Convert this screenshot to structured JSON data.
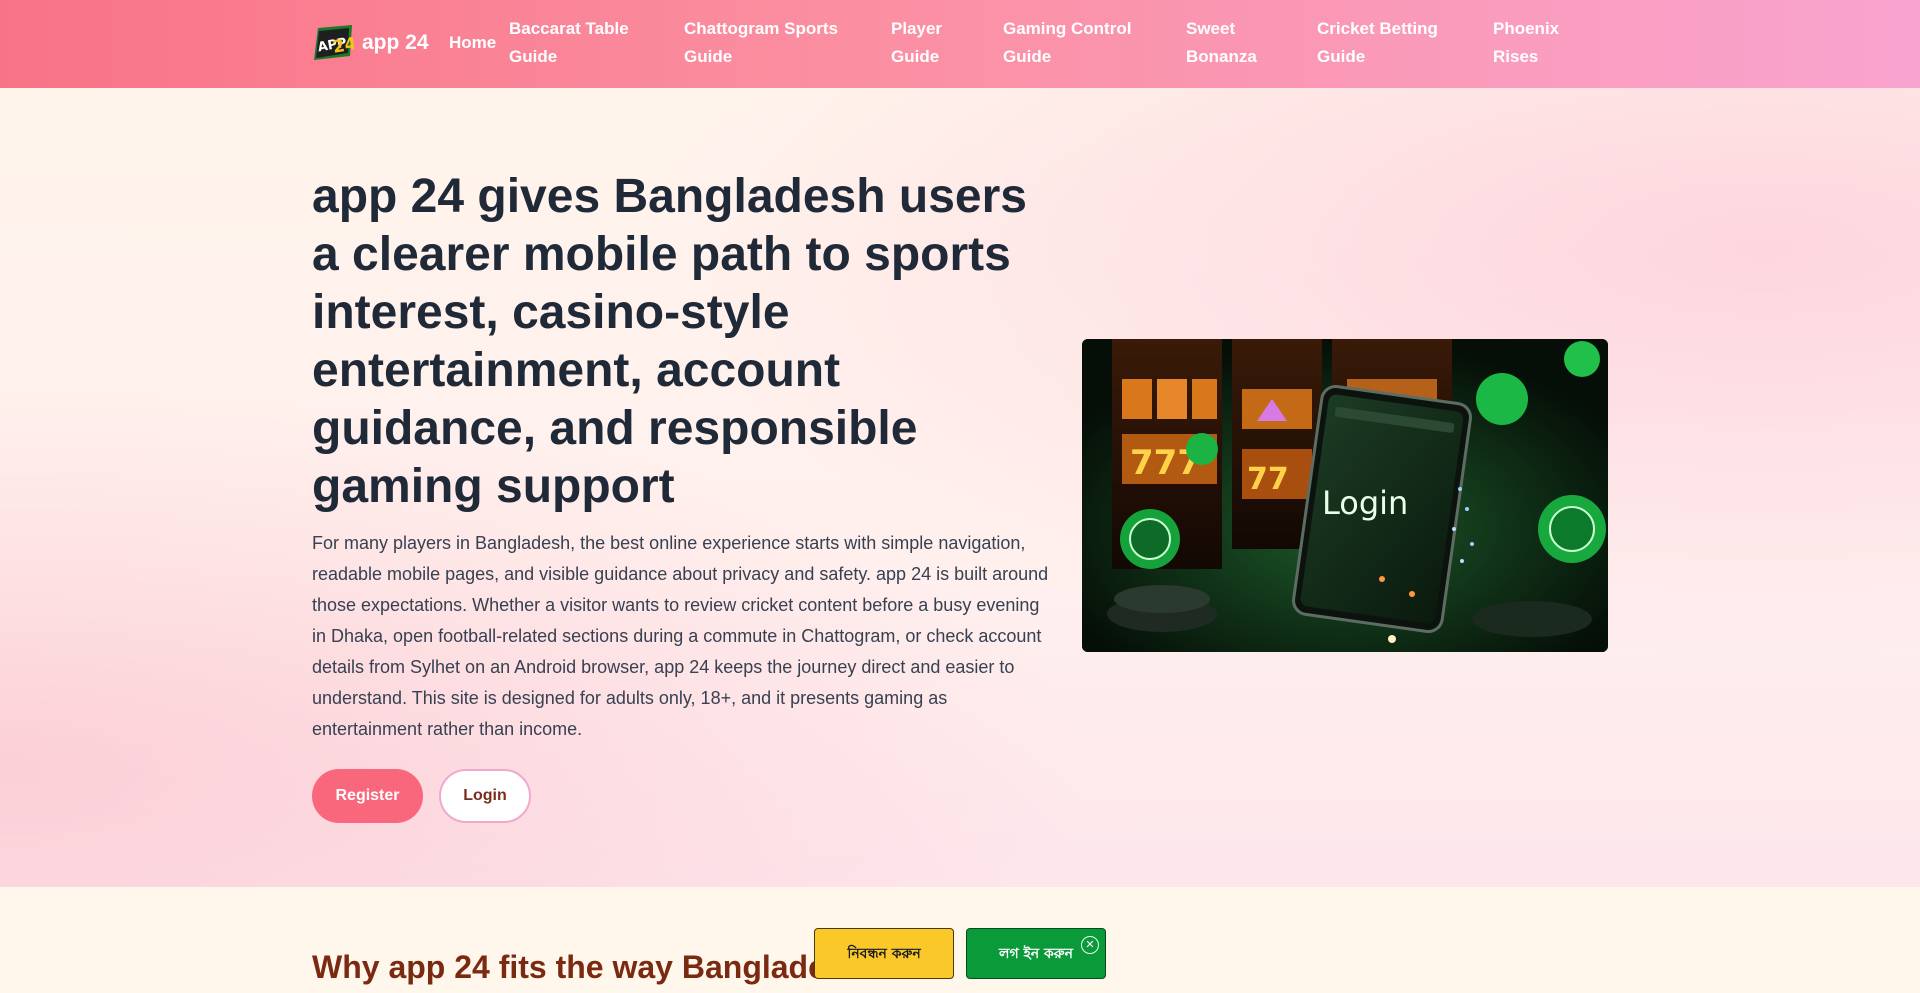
{
  "header": {
    "brand_name": "app 24",
    "logo_text": "APP24",
    "nav": [
      {
        "label": "Home"
      },
      {
        "label": "Baccarat Table Guide"
      },
      {
        "label": "Chattogram Sports Guide"
      },
      {
        "label": "Player Guide"
      },
      {
        "label": "Gaming Control Guide"
      },
      {
        "label": "Sweet Bonanza"
      },
      {
        "label": "Cricket Betting Guide"
      },
      {
        "label": "Phoenix Rises"
      }
    ]
  },
  "hero": {
    "title": "app 24 gives Bangladesh users a clearer mobile path to sports interest, casino-style entertainment, account guidance, and responsible gaming support",
    "text": "For many players in Bangladesh, the best online experience starts with simple navigation, readable mobile pages, and visible guidance about privacy and safety. app 24 is built around those expectations. Whether a visitor wants to review cricket content before a busy evening in Dhaka, open football-related sections during a commute in Chattogram, or check account details from Sylhet on an Android browser, app 24 keeps the journey direct and easier to understand. This site is designed for adults only, 18+, and it presents gaming as entertainment rather than income.",
    "register_label": "Register",
    "login_label": "Login",
    "image_label": "Login"
  },
  "section": {
    "title": "Why app 24 fits the way Bangladesh"
  },
  "floating_bar": {
    "register_label": "নিবন্ধন করুন",
    "login_label": "লগ ইন করুন",
    "close_symbol": "✕"
  },
  "colors": {
    "header_start": "#f97386",
    "header_end": "#f9a4cf",
    "register_button": "#f9677d",
    "section_title": "#7b2a12",
    "float_register": "#fbc82a",
    "float_login": "#0b9a3a"
  }
}
